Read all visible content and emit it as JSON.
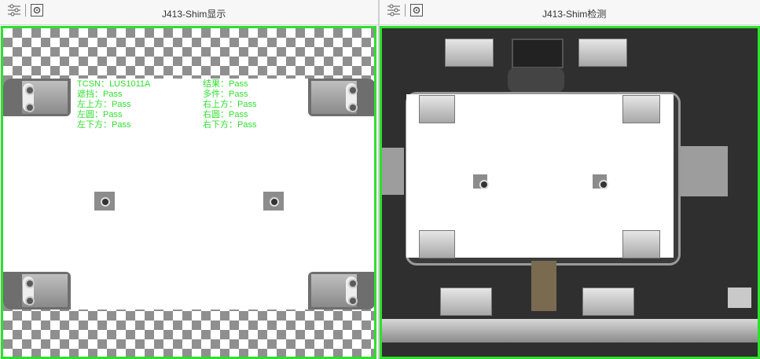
{
  "left_panel": {
    "title": "J413-Shim显示",
    "toolbar_icons": [
      "settings-sliders-icon",
      "image-settings-icon"
    ],
    "overlay": {
      "left_lines": [
        "TCSN：LUS1011A",
        "遮挡：Pass",
        "左上方：Pass",
        "左圆：Pass",
        "左下方：Pass"
      ],
      "right_lines": [
        "结果：Pass",
        "多件：Pass",
        "右上方：Pass",
        "右圆：Pass",
        "右下方：Pass"
      ],
      "text_color": "#2ee02e"
    }
  },
  "right_panel": {
    "title": "J413-Shim检测",
    "toolbar_icons": [
      "settings-sliders-icon",
      "image-settings-icon"
    ]
  },
  "colors": {
    "roi_border": "#2ee02e"
  }
}
